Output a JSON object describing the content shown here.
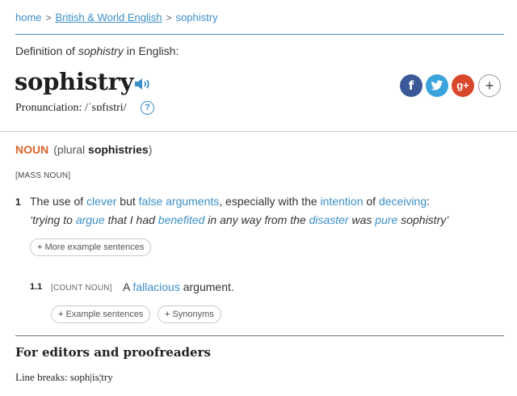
{
  "breadcrumb": {
    "home": "home",
    "section": "British & World English",
    "current": "sophistry",
    "sep": ">"
  },
  "definition_of": {
    "prefix": "Definition of ",
    "word": "sophistry",
    "suffix": " in English:"
  },
  "headword": "sophistry",
  "pronunciation": {
    "label": "Pronunciation: ",
    "ipa": "/ˈsɒfɪstri/",
    "help": "?"
  },
  "share": {
    "facebook": "f",
    "google": "g+",
    "more": "+"
  },
  "part_of_speech": {
    "label": "NOUN",
    "plural_prefix": "(plural ",
    "plural": "sophistries",
    "plural_suffix": ")"
  },
  "grammar_label": "[MASS NOUN]",
  "sense1": {
    "number": "1",
    "t1": "The use of ",
    "l1": "clever",
    "t2": " but ",
    "l2": "false arguments",
    "t3": ", especially with the ",
    "l3": "intention",
    "t4": " of ",
    "l4": "deceiving",
    "t5": ":",
    "ex": {
      "e1": "‘trying to ",
      "l1": "argue",
      "e2": " that I had ",
      "l2": "benefited",
      "e3": " in any way from the ",
      "l3": "disaster",
      "e4": " was ",
      "l4": "pure",
      "e5": " sophistry’"
    },
    "more_button": "More example sentences"
  },
  "subsense": {
    "number": "1.1",
    "label": "[COUNT NOUN]",
    "t1": "A ",
    "l1": "fallacious",
    "t2": " argument.",
    "examples_button": "Example sentences",
    "synonyms_button": "Synonyms"
  },
  "plus_sign": "+",
  "editors_heading": "For editors and proofreaders",
  "line_breaks": "Line breaks: soph|is¦try",
  "colors": {
    "link": "#3b8fc8",
    "noun": "#d9642b",
    "facebook": "#3b5998",
    "twitter": "#3ba3dc",
    "google": "#d9472b"
  }
}
